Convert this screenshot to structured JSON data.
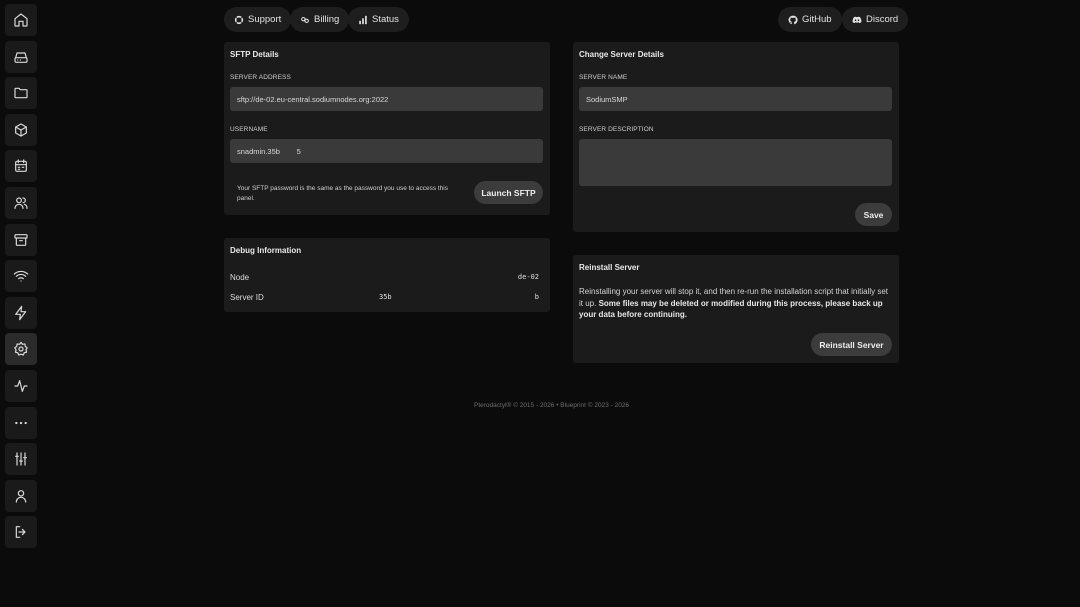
{
  "sidebar": {
    "items": [
      {
        "icon": "home-icon"
      },
      {
        "icon": "drive-icon"
      },
      {
        "icon": "folder-icon"
      },
      {
        "icon": "box-icon"
      },
      {
        "icon": "calendar-icon"
      },
      {
        "icon": "users-icon"
      },
      {
        "icon": "archive-icon"
      },
      {
        "icon": "wifi-icon"
      },
      {
        "icon": "bolt-icon"
      },
      {
        "icon": "settings-icon",
        "active": true
      },
      {
        "icon": "activity-icon"
      },
      {
        "icon": "more-icon"
      },
      {
        "icon": "sliders-icon"
      },
      {
        "icon": "user-icon"
      },
      {
        "icon": "logout-icon"
      }
    ]
  },
  "top_links": {
    "support": "Support",
    "billing": "Billing",
    "status": "Status",
    "github": "GitHub",
    "discord": "Discord"
  },
  "sftp": {
    "title": "SFTP Details",
    "address_label": "SERVER ADDRESS",
    "address_value": "sftp://de-02.eu-central.sodiumnodes.org:2022",
    "username_label": "USERNAME",
    "username_value": "snadmin.35b        5",
    "note": "Your SFTP password is the same as the password you use to access this panel.",
    "launch_button": "Launch SFTP"
  },
  "debug": {
    "title": "Debug Information",
    "node_label": "Node",
    "node_value": "de-02",
    "server_id_label": "Server ID",
    "server_id_part1": "35b",
    "server_id_part2": "b"
  },
  "change_details": {
    "title": "Change Server Details",
    "name_label": "SERVER NAME",
    "name_value": "SodiumSMP",
    "description_label": "SERVER DESCRIPTION",
    "description_value": "",
    "save_button": "Save"
  },
  "reinstall": {
    "title": "Reinstall Server",
    "text_normal": "Reinstalling your server will stop it, and then re-run the installation script that initially set it up. ",
    "text_bold": "Some files may be deleted or modified during this process, please back up your data before continuing.",
    "button": "Reinstall Server"
  },
  "footer": {
    "text": "Pterodactyl® © 2015 - 2026  •  Blueprint © 2023 - 2026"
  }
}
